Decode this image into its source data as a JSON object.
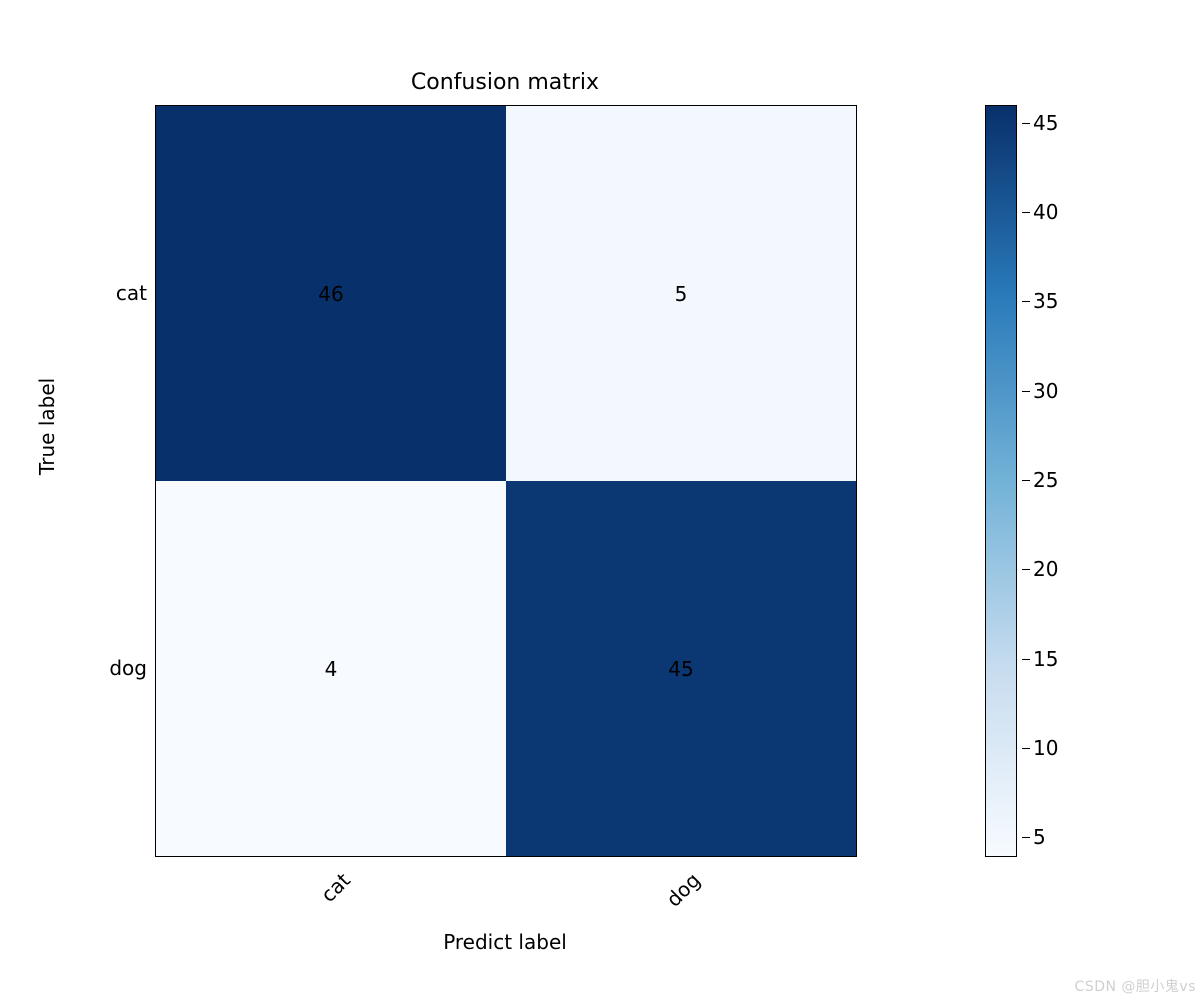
{
  "chart_data": {
    "type": "heatmap",
    "title": "Confusion matrix",
    "xlabel": "Predict label",
    "ylabel": "True label",
    "x_categories": [
      "cat",
      "dog"
    ],
    "y_categories": [
      "cat",
      "dog"
    ],
    "values": [
      [
        46,
        5
      ],
      [
        4,
        45
      ]
    ],
    "value_range": [
      4,
      46
    ],
    "colorbar_ticks": [
      5,
      10,
      15,
      20,
      25,
      30,
      35,
      40,
      45
    ],
    "cmap": "Blues",
    "cmap_stops": [
      {
        "t": 0.0,
        "color": "#f7fbff"
      },
      {
        "t": 0.25,
        "color": "#c7dcef"
      },
      {
        "t": 0.5,
        "color": "#72b2d7"
      },
      {
        "t": 0.75,
        "color": "#2979b9"
      },
      {
        "t": 1.0,
        "color": "#08306b"
      }
    ]
  },
  "watermark": "CSDN @胆小鬼vs"
}
